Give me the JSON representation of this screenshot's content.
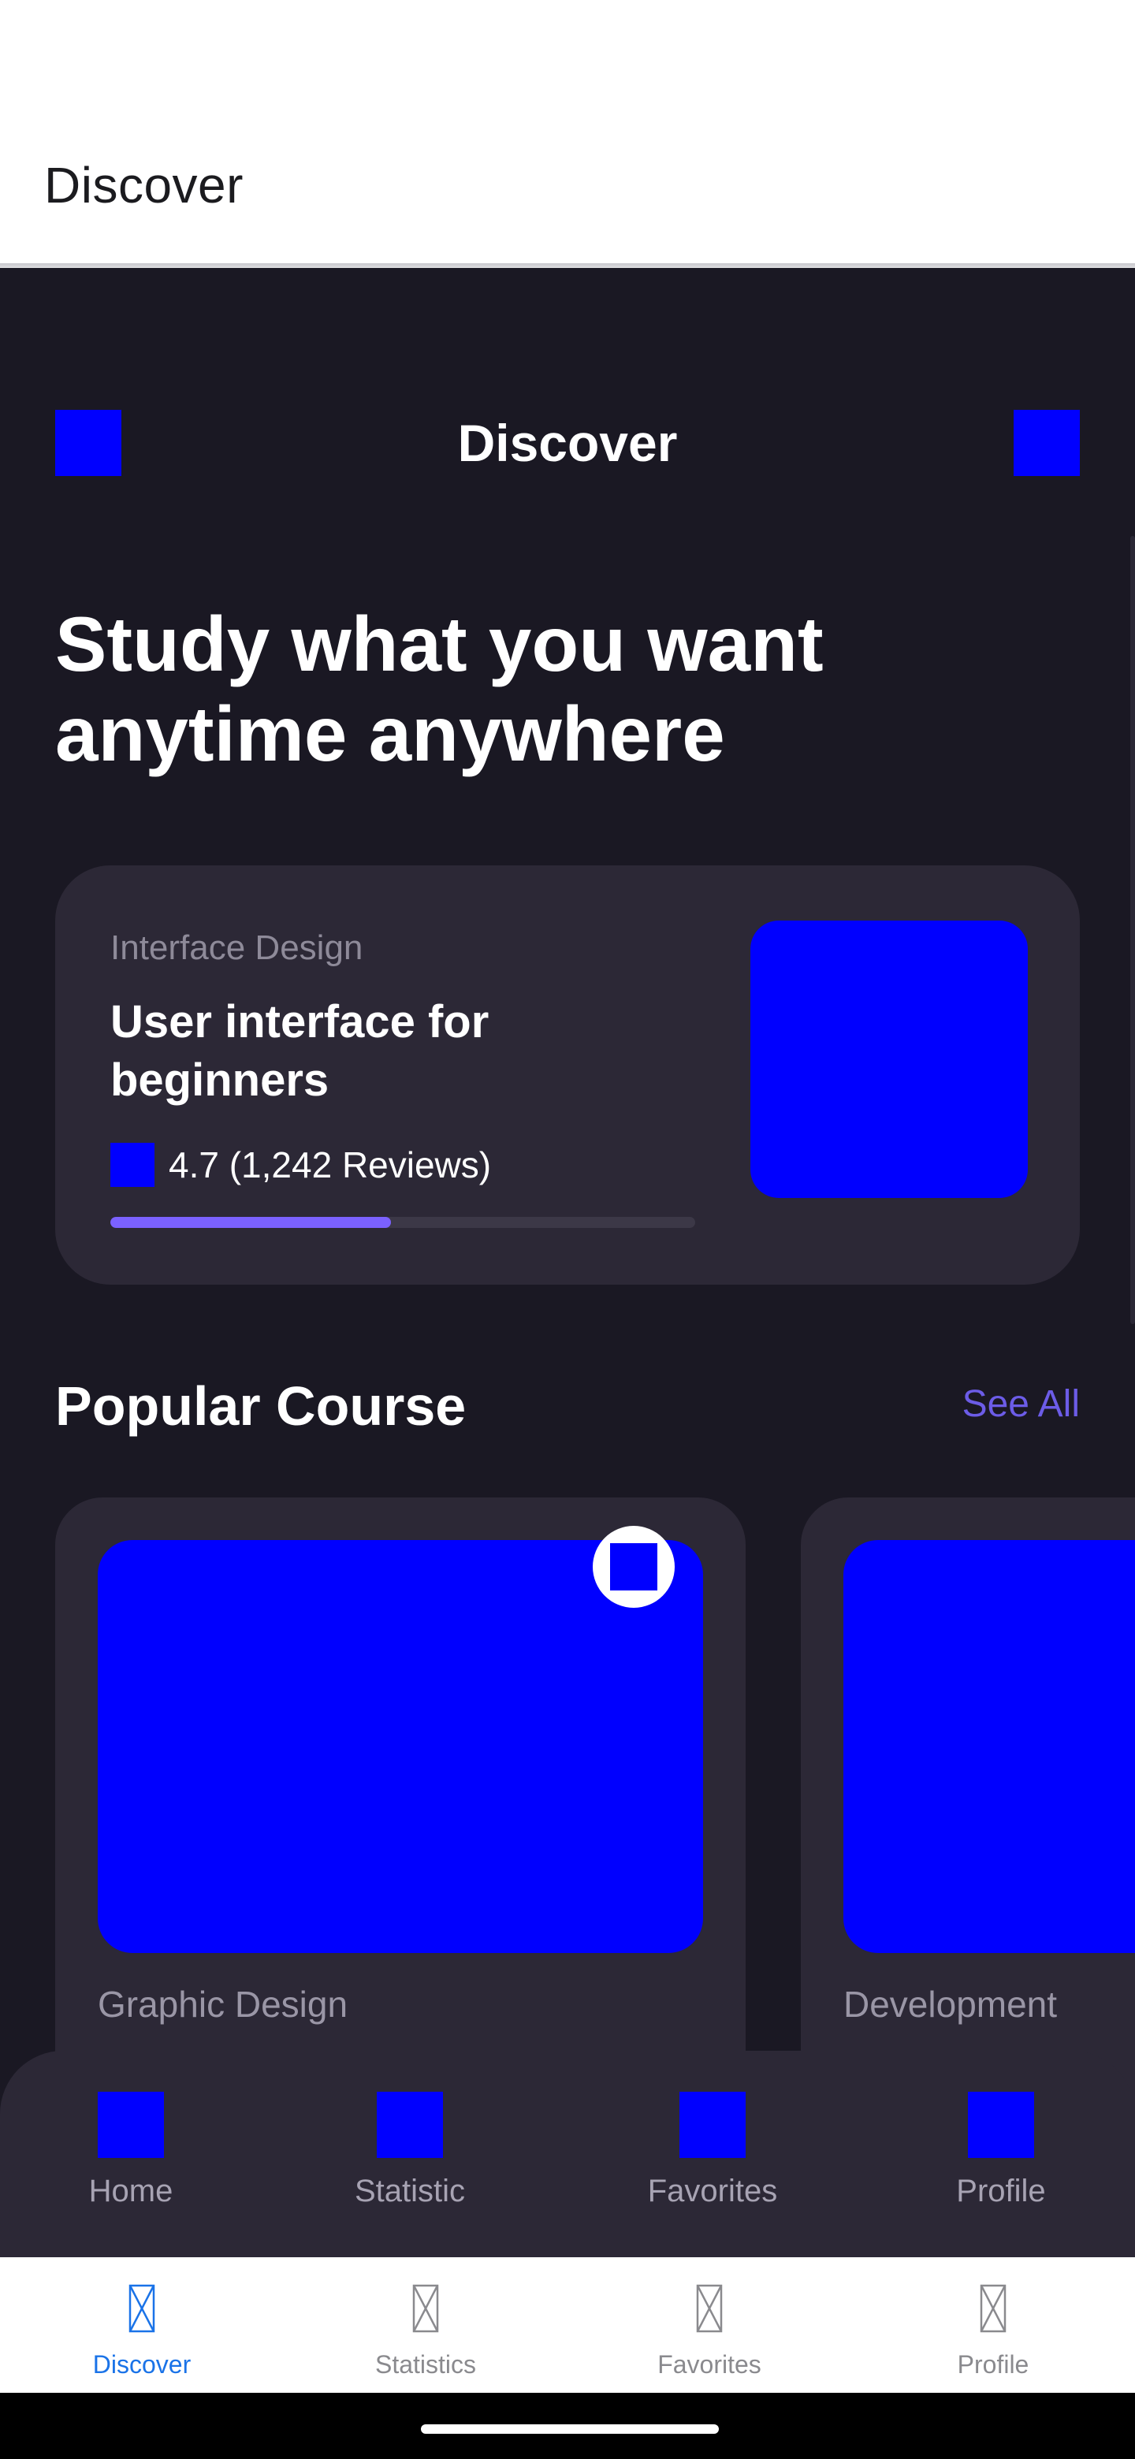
{
  "app_header": {
    "title": "Discover"
  },
  "topbar": {
    "title": "Discover"
  },
  "hero": {
    "text": "Study what you want anytime anywhere"
  },
  "featured": {
    "category": "Interface Design",
    "title": "User interface for beginners",
    "rating": "4.7 (1,242 Reviews)",
    "progress_percent": 48
  },
  "popular": {
    "title": "Popular Course",
    "see_all": "See All",
    "courses": [
      {
        "category": "Graphic Design"
      },
      {
        "category": "Development"
      }
    ]
  },
  "inner_nav": {
    "items": [
      {
        "label": "Home"
      },
      {
        "label": "Statistic"
      },
      {
        "label": "Favorites"
      },
      {
        "label": "Profile"
      }
    ]
  },
  "tabbar": {
    "items": [
      {
        "label": "Discover",
        "active": true
      },
      {
        "label": "Statistics",
        "active": false
      },
      {
        "label": "Favorites",
        "active": false
      },
      {
        "label": "Profile",
        "active": false
      }
    ]
  },
  "colors": {
    "background": "#1a1823",
    "card": "#2c2836",
    "accent": "#6c5ce7",
    "progress": "#7b61ff",
    "placeholder": "#0000ff",
    "tab_active": "#1a73e8"
  }
}
